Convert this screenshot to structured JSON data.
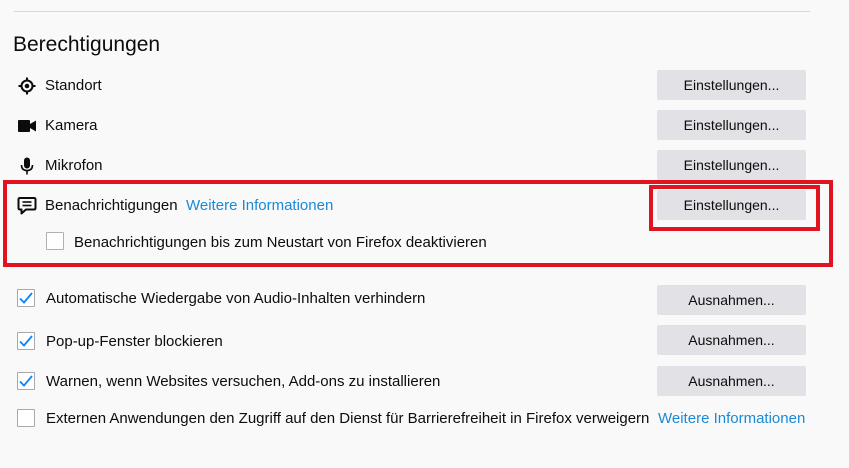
{
  "section": {
    "title": "Berechtigungen"
  },
  "permissions": [
    {
      "label": "Standort",
      "icon": "location-icon",
      "button": "Einstellungen..."
    },
    {
      "label": "Kamera",
      "icon": "camera-icon",
      "button": "Einstellungen..."
    },
    {
      "label": "Mikrofon",
      "icon": "microphone-icon",
      "button": "Einstellungen..."
    },
    {
      "label": "Benachrichtigungen",
      "icon": "notification-icon",
      "button": "Einstellungen...",
      "link": "Weitere Informationen"
    }
  ],
  "notifications_pause": {
    "label": "Benachrichtigungen bis zum Neustart von Firefox deaktivieren",
    "checked": false
  },
  "checkboxes": [
    {
      "label": "Automatische Wiedergabe von Audio-Inhalten verhindern",
      "checked": true,
      "button": "Ausnahmen..."
    },
    {
      "label": "Pop-up-Fenster blockieren",
      "checked": true,
      "button": "Ausnahmen..."
    },
    {
      "label": "Warnen, wenn Websites versuchen, Add-ons zu installieren",
      "checked": true,
      "button": "Ausnahmen..."
    },
    {
      "label": "Externen Anwendungen den Zugriff auf den Dienst für Barrierefreiheit in Firefox verweigern",
      "checked": false,
      "link": "Weitere Informationen"
    }
  ],
  "colors": {
    "link": "#1a8ad6",
    "checkbox_check": "#0a84ff",
    "highlight": "#e0141e",
    "button_bg": "#e2e2e6"
  }
}
